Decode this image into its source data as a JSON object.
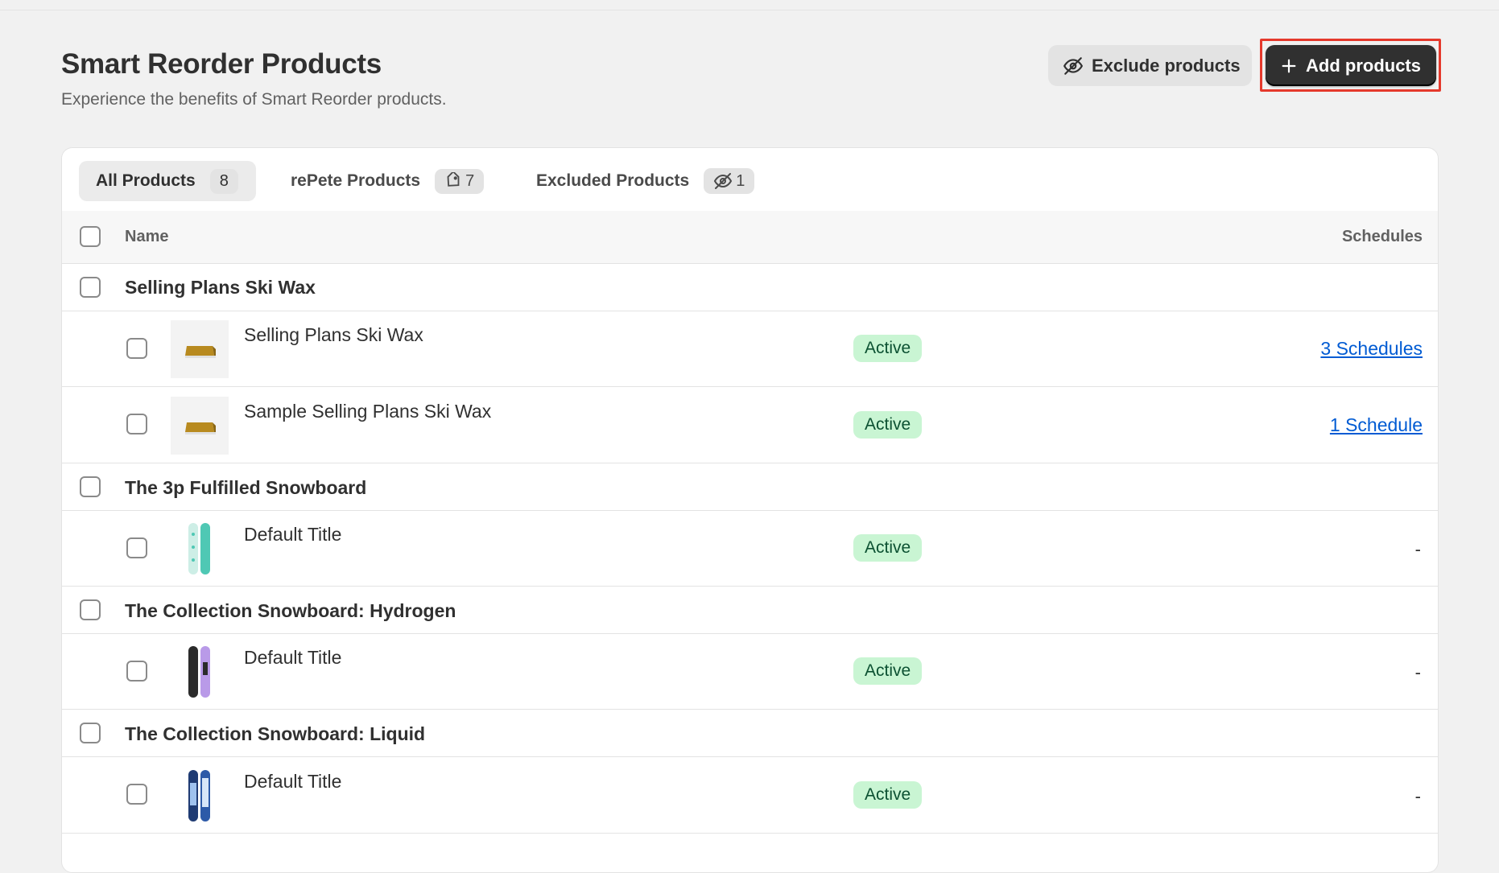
{
  "header": {
    "title": "Smart Reorder Products",
    "subtitle": "Experience the benefits of Smart Reorder products.",
    "exclude_label": "Exclude products",
    "add_label": "Add products"
  },
  "tabs": [
    {
      "label": "All Products",
      "count": "8"
    },
    {
      "label": "rePete Products",
      "count": "7"
    },
    {
      "label": "Excluded Products",
      "count": "1"
    }
  ],
  "table": {
    "col_name": "Name",
    "col_schedules": "Schedules",
    "groups": [
      {
        "title": "Selling Plans Ski Wax"
      },
      {
        "title": "The 3p Fulfilled Snowboard"
      },
      {
        "title": "The Collection Snowboard: Hydrogen"
      },
      {
        "title": "The Collection Snowboard: Liquid"
      }
    ],
    "variants": [
      {
        "title": "Selling Plans Ski Wax",
        "status": "Active",
        "schedules": "3 Schedules",
        "image": "ski-wax"
      },
      {
        "title": "Sample Selling Plans Ski Wax",
        "status": "Active",
        "schedules": "1 Schedule",
        "image": "ski-wax"
      },
      {
        "title": "Default Title",
        "status": "Active",
        "schedules": "-",
        "image": "snowboard-teal"
      },
      {
        "title": "Default Title",
        "status": "Active",
        "schedules": "-",
        "image": "snowboard-hydrogen"
      },
      {
        "title": "Default Title",
        "status": "Active",
        "schedules": "-",
        "image": "snowboard-liquid"
      }
    ]
  },
  "colors": {
    "accent": "#303030",
    "highlight": "#e5392c",
    "badge_bg": "#c9f5d3",
    "link": "#005bd3"
  }
}
